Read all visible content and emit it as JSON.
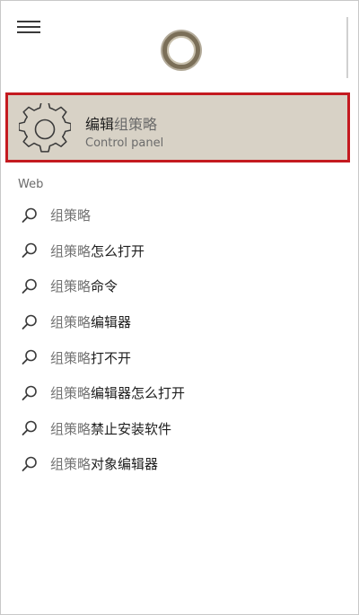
{
  "header": {
    "menu_icon": "hamburger-icon",
    "assistant_icon": "cortana-circle-icon"
  },
  "best_match": {
    "icon": "gear-icon",
    "title_bold": "编辑",
    "title_rest": "组策略",
    "subtitle": "Control panel"
  },
  "web": {
    "section_label": "Web",
    "results": [
      {
        "query": "组策略",
        "suffix": ""
      },
      {
        "query": "组策略",
        "suffix": "怎么打开"
      },
      {
        "query": "组策略",
        "suffix": "命令"
      },
      {
        "query": "组策略",
        "suffix": "编辑器"
      },
      {
        "query": "组策略",
        "suffix": "打不开"
      },
      {
        "query": "组策略",
        "suffix": "编辑器怎么打开"
      },
      {
        "query": "组策略",
        "suffix": "禁止安装软件"
      },
      {
        "query": "组策略",
        "suffix": "对象编辑器"
      }
    ],
    "result_icon": "search-icon"
  },
  "colors": {
    "highlight_bg": "#d8d2c6",
    "highlight_border": "#c41a20",
    "cortana_ring": "#7b6f58"
  }
}
